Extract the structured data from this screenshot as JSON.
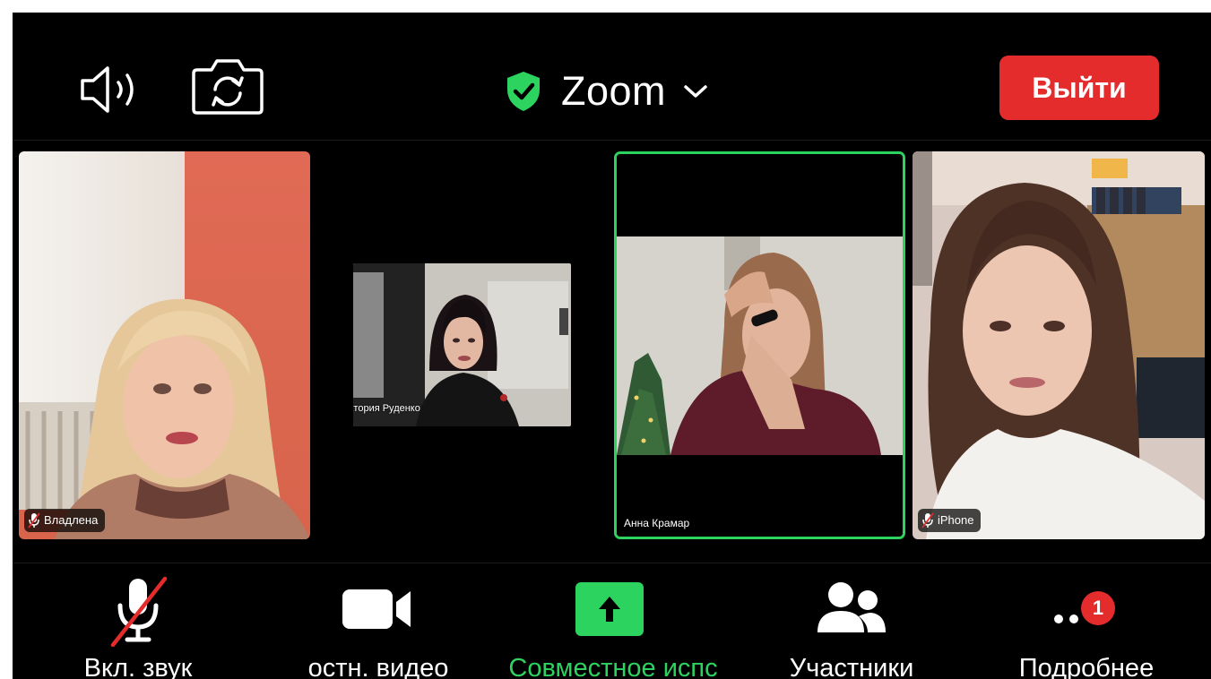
{
  "topbar": {
    "title": "Zoom",
    "leave_label": "Выйти",
    "speaker_icon": "speaker-icon",
    "camera_flip_icon": "camera-switch-icon",
    "security_icon": "shield-check-icon",
    "chevron_icon": "chevron-down-icon"
  },
  "participants": [
    {
      "name": "Владлена",
      "muted_icon": "mic-muted-icon"
    },
    {
      "name": "Виктория Руденко"
    },
    {
      "name": "Анна Крамар",
      "active_speaker": true
    },
    {
      "name": "iPhone",
      "muted_icon": "mic-muted-icon"
    }
  ],
  "toolbar": {
    "items": [
      {
        "label": "Вкл. звук",
        "icon": "mic-muted-icon"
      },
      {
        "label": "остн. видео",
        "icon": "video-camera-icon"
      },
      {
        "label": "Совместное испс",
        "icon": "share-screen-icon"
      },
      {
        "label": "Участники",
        "icon": "participants-icon"
      },
      {
        "label": "Подробнее",
        "icon": "more-icon",
        "badge": "1"
      }
    ]
  },
  "colors": {
    "background": "#000000",
    "accent_green": "#2cd35f",
    "leave_red": "#e32c2b",
    "text": "#ffffff"
  }
}
